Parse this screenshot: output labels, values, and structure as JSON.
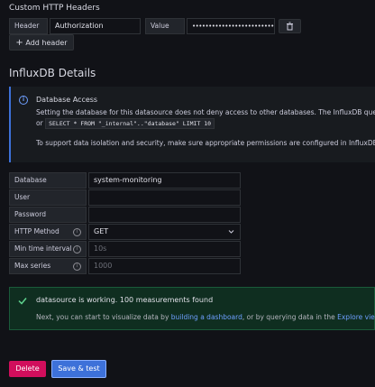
{
  "custom_headers": {
    "title": "Custom HTTP Headers",
    "header_label": "Header",
    "header_value": "Authorization",
    "value_label": "Value",
    "value_masked": "••••••••••••••••••••••••••",
    "add_header_label": "Add header"
  },
  "influx": {
    "title": "InfluxDB Details",
    "alert": {
      "title": "Database Access",
      "line1": "Setting the database for this datasource does not deny access to other databases. The InfluxDB query sy",
      "line2_prefix": "or",
      "code": "SELECT * FROM \"_internal\"..\"database\" LIMIT 10",
      "line3": "To support data isolation and security, make sure appropriate permissions are configured in InfluxDB."
    },
    "fields": {
      "database_label": "Database",
      "database_value": "system-monitoring",
      "user_label": "User",
      "password_label": "Password",
      "http_method_label": "HTTP Method",
      "http_method_value": "GET",
      "min_interval_label": "Min time interval",
      "min_interval_placeholder": "10s",
      "max_series_label": "Max series",
      "max_series_placeholder": "1000"
    }
  },
  "status": {
    "title": "datasource is working. 100 measurements found",
    "text_prefix": "Next, you can start to visualize data by",
    "link1": "building a dashboard",
    "text_middle": ", or by querying data in the",
    "link2": "Explore view",
    "text_suffix": "."
  },
  "actions": {
    "delete_label": "Delete",
    "save_label": "Save & test"
  },
  "colors": {
    "success": "#1a7f4b",
    "info": "#3d71d9",
    "delete": "#d10e5c",
    "primary": "#3d71d9"
  }
}
